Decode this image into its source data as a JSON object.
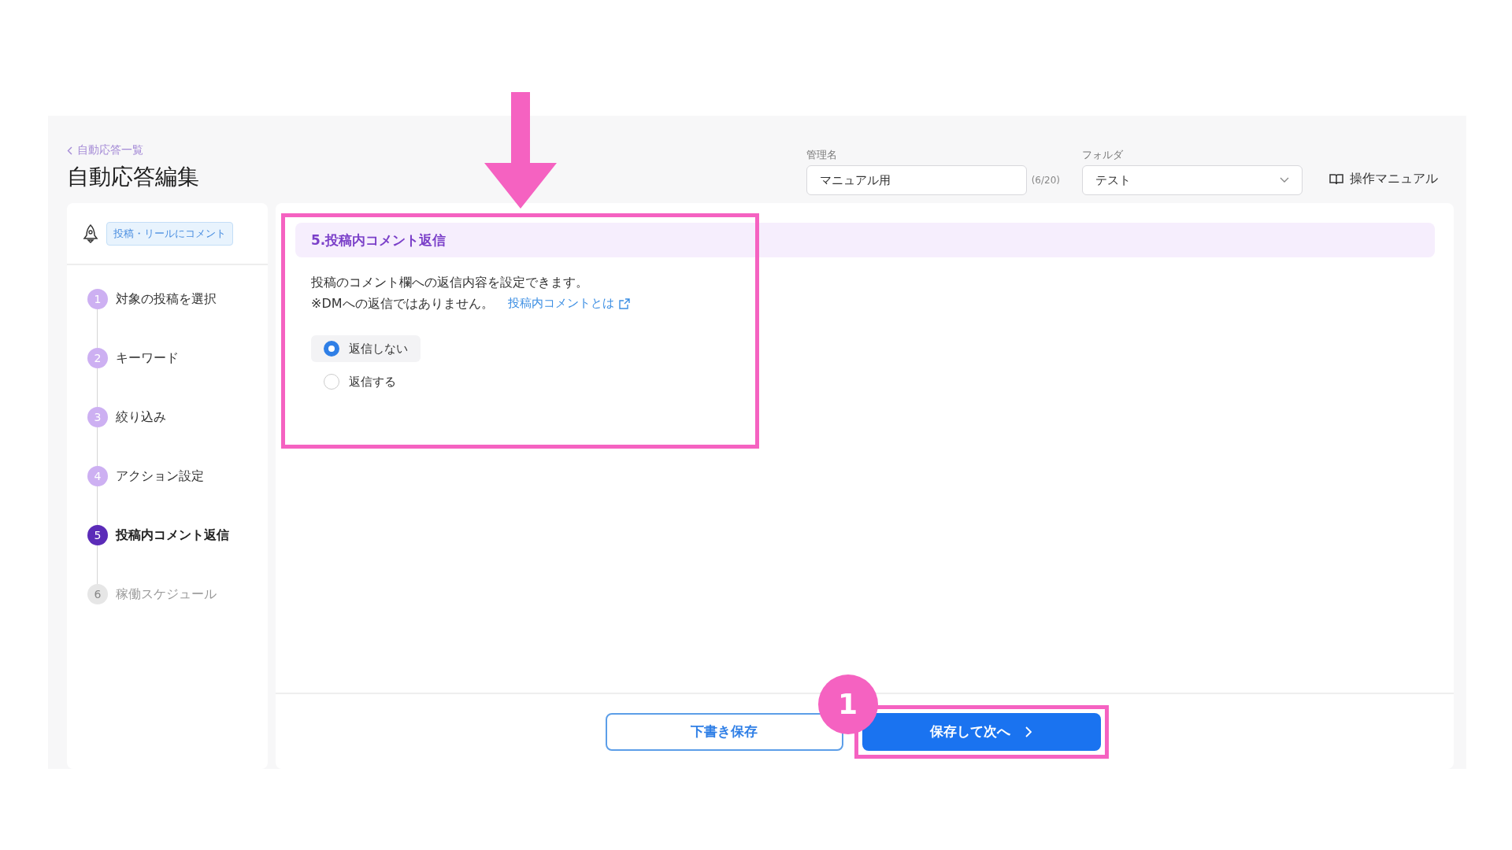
{
  "breadcrumb": "自動応答一覧",
  "page_title": "自動応答編集",
  "header": {
    "name_label": "管理名",
    "name_value": "マニュアル用",
    "name_count": "(6/20)",
    "folder_label": "フォルダ",
    "folder_value": "テスト",
    "manual_link": "操作マニュアル"
  },
  "sidebar": {
    "trigger_tag": "投稿・リールにコメント",
    "steps": [
      {
        "number": "1",
        "label": "対象の投稿を選択",
        "selected": false,
        "disabled": false
      },
      {
        "number": "2",
        "label": "キーワード",
        "selected": false,
        "disabled": false
      },
      {
        "number": "3",
        "label": "絞り込み",
        "selected": false,
        "disabled": false
      },
      {
        "number": "4",
        "label": "アクション設定",
        "selected": false,
        "disabled": false
      },
      {
        "number": "5",
        "label": "投稿内コメント返信",
        "selected": true,
        "disabled": false
      },
      {
        "number": "6",
        "label": "稼働スケジュール",
        "selected": false,
        "disabled": true
      }
    ]
  },
  "section": {
    "title": "5.投稿内コメント返信",
    "description": "投稿のコメント欄への返信内容を設定できます。",
    "note": "※DMへの返信ではありません。",
    "help_link": "投稿内コメントとは",
    "options": [
      {
        "label": "返信しない",
        "selected": true
      },
      {
        "label": "返信する",
        "selected": false
      }
    ]
  },
  "footer": {
    "draft_button": "下書き保存",
    "next_button": "保存して次へ"
  },
  "annotation": {
    "badge": "1"
  }
}
